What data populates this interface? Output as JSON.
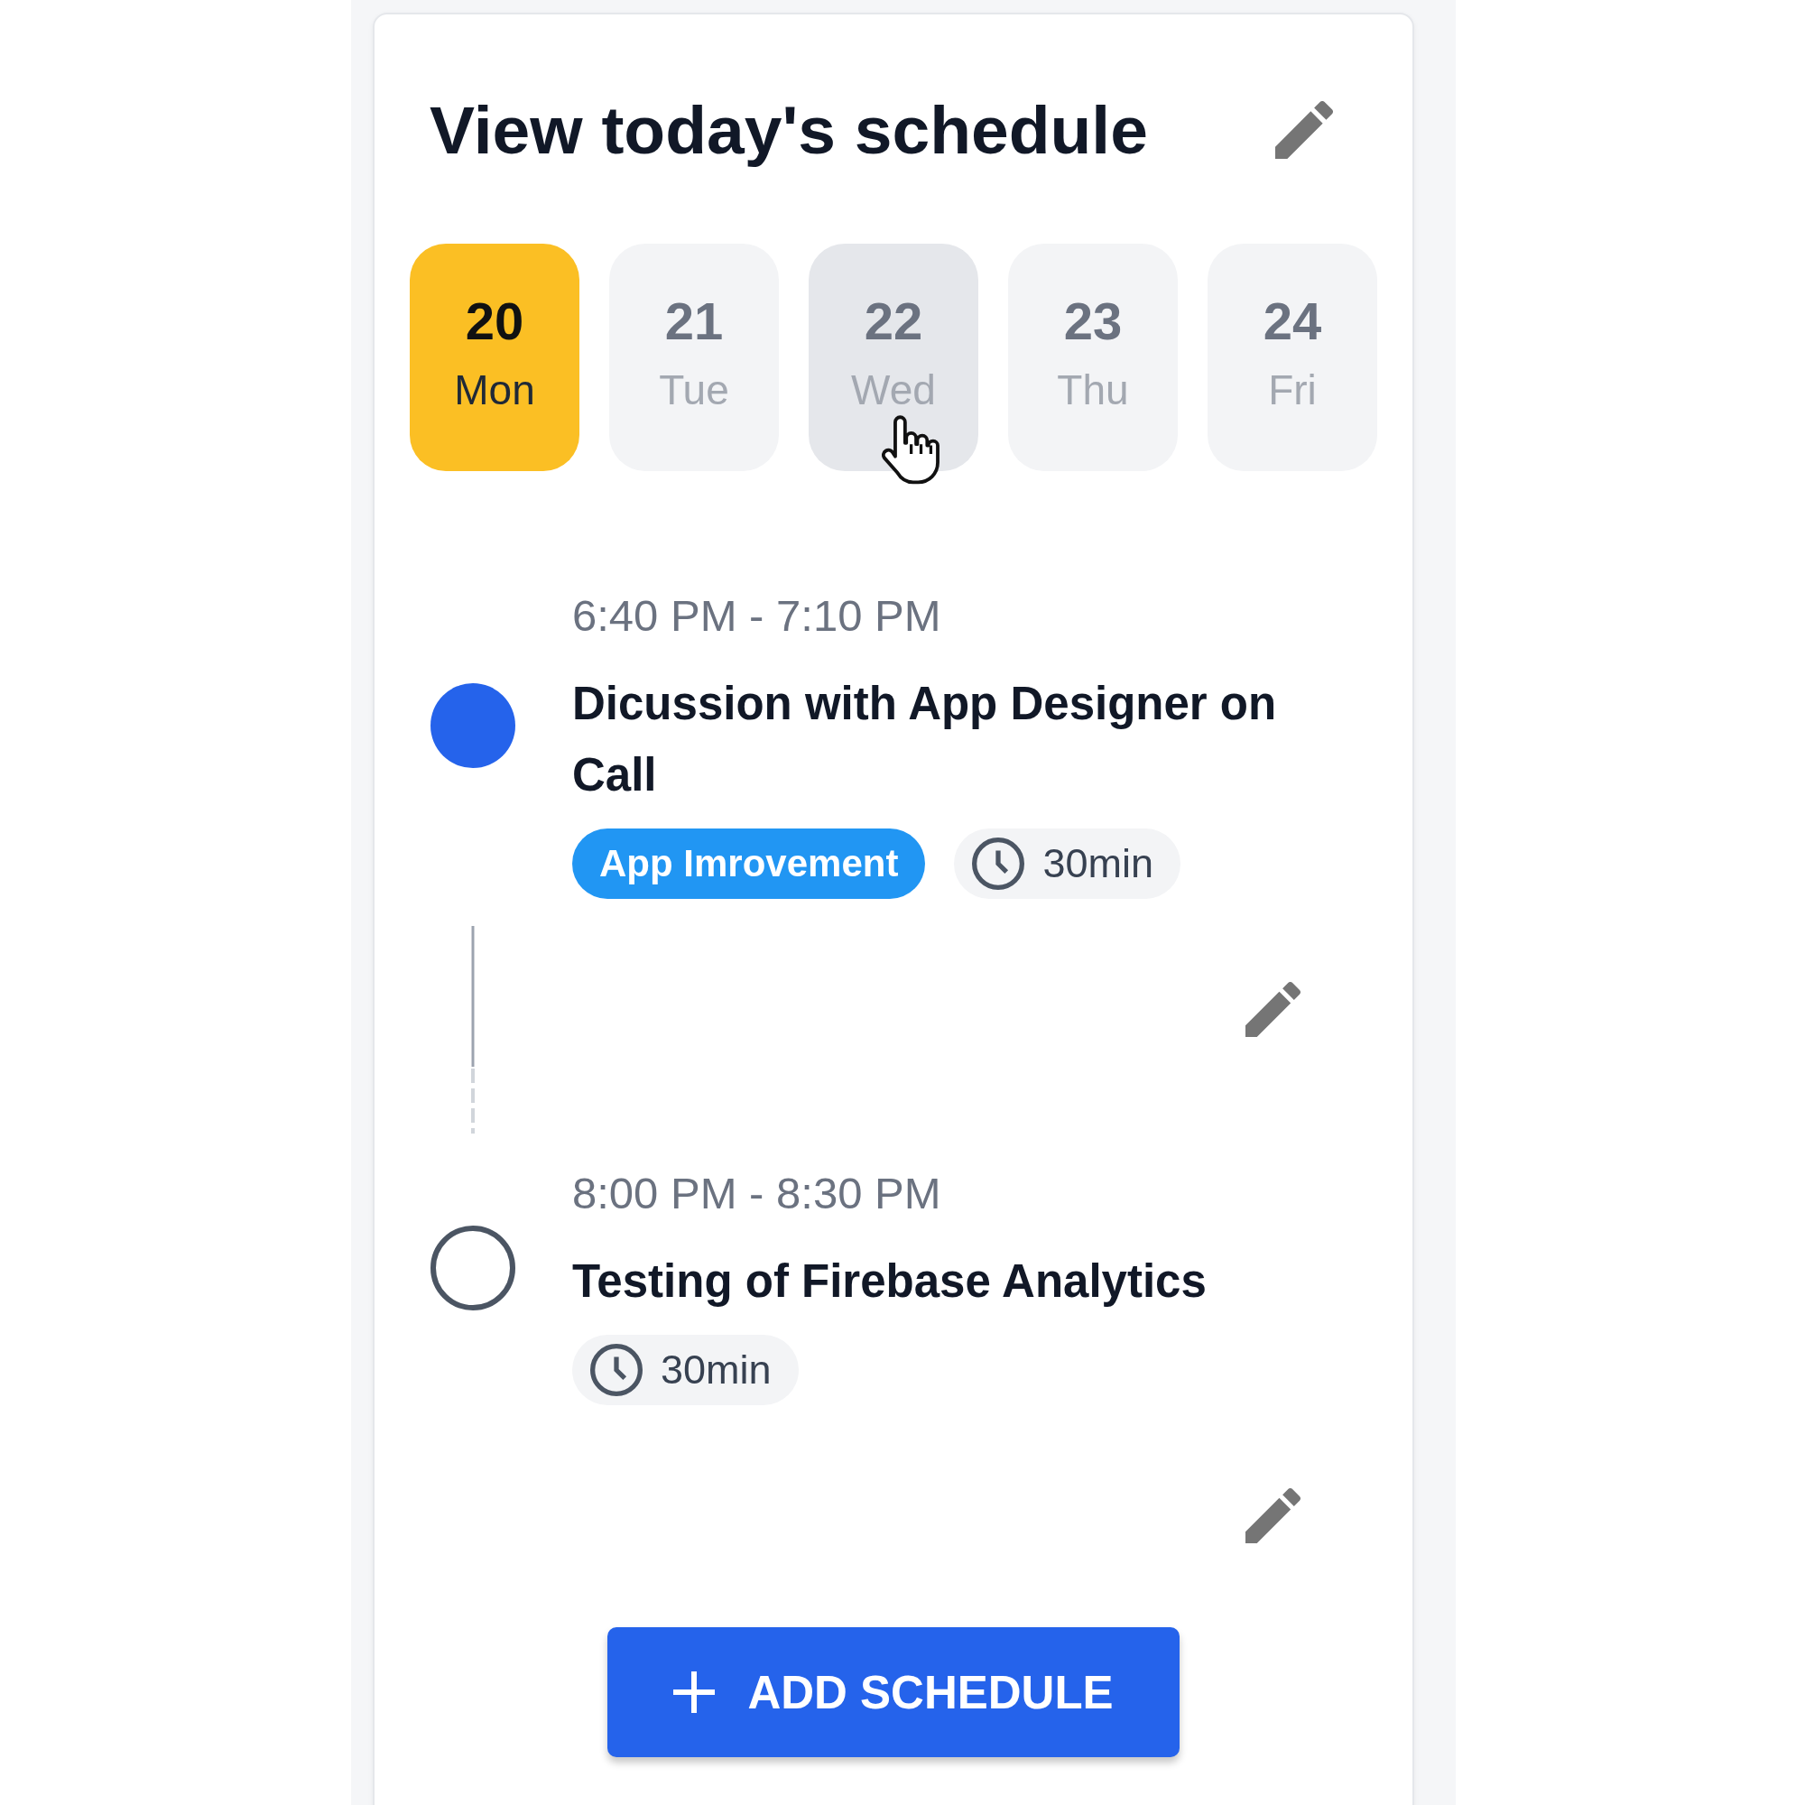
{
  "card": {
    "title": "View today's schedule"
  },
  "days": [
    {
      "date": "20",
      "weekday": "Mon",
      "selected": true,
      "hovered": false
    },
    {
      "date": "21",
      "weekday": "Tue",
      "selected": false,
      "hovered": false
    },
    {
      "date": "22",
      "weekday": "Wed",
      "selected": false,
      "hovered": true
    },
    {
      "date": "23",
      "weekday": "Thu",
      "selected": false,
      "hovered": false
    },
    {
      "date": "24",
      "weekday": "Fri",
      "selected": false,
      "hovered": false
    }
  ],
  "events": [
    {
      "time": "6:40 PM - 7:10 PM",
      "title": "Dicussion with App Designer on Call",
      "active": true,
      "tag": "App Imrovement",
      "duration": "30min"
    },
    {
      "time": "8:00 PM - 8:30 PM",
      "title": "Testing of Firebase Analytics",
      "active": false,
      "duration": "30min"
    }
  ],
  "add_button": {
    "label": "ADD SCHEDULE"
  }
}
